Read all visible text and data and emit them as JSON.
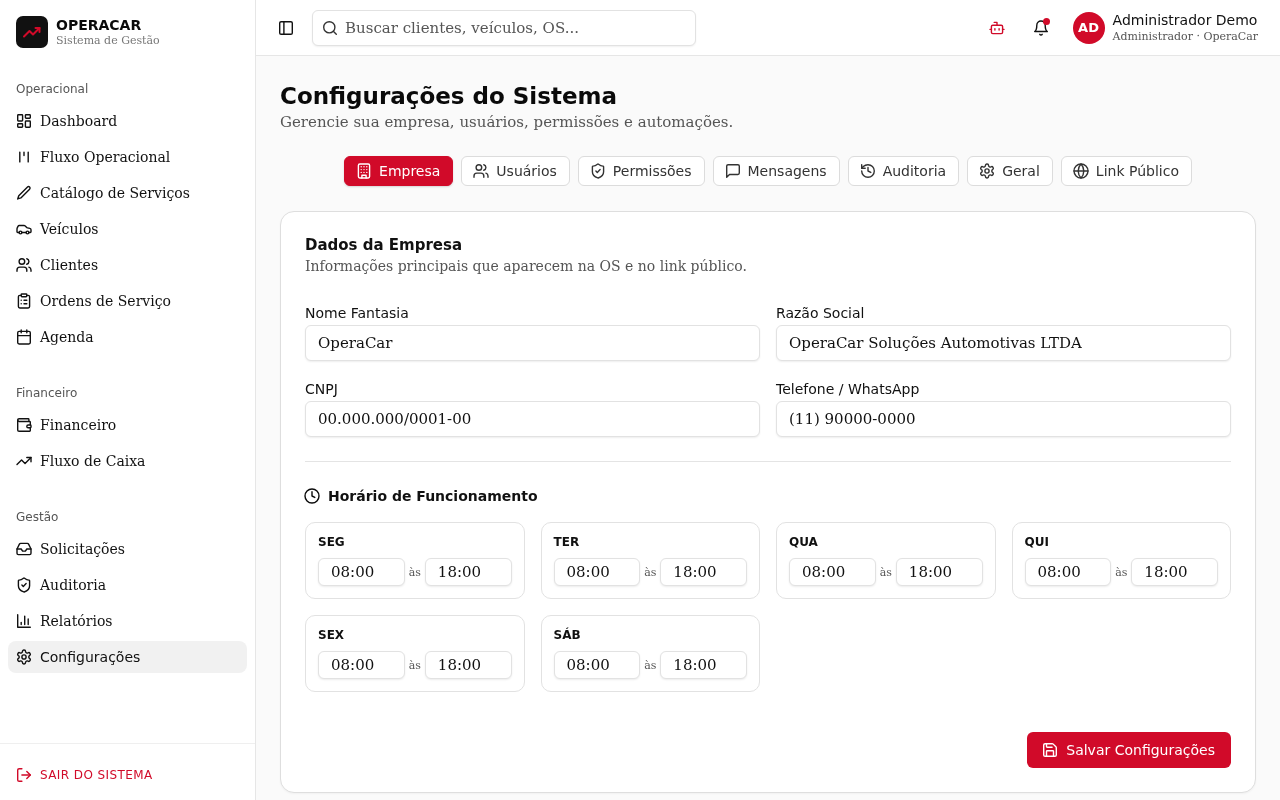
{
  "sidebar": {
    "brand": {
      "name": "OPERACAR",
      "subtitle": "Sistema de Gestão"
    },
    "sections": [
      {
        "title": "Operacional",
        "items": [
          {
            "label": "Dashboard",
            "selected": false
          },
          {
            "label": "Fluxo Operacional",
            "selected": false
          },
          {
            "label": "Catálogo de Serviços",
            "selected": false
          },
          {
            "label": "Veículos",
            "selected": false
          },
          {
            "label": "Clientes",
            "selected": false
          },
          {
            "label": "Ordens de Serviço",
            "selected": false
          },
          {
            "label": "Agenda",
            "selected": false
          }
        ]
      },
      {
        "title": "Financeiro",
        "items": [
          {
            "label": "Financeiro",
            "selected": false
          },
          {
            "label": "Fluxo de Caixa",
            "selected": false
          }
        ]
      },
      {
        "title": "Gestão",
        "items": [
          {
            "label": "Solicitações",
            "selected": false
          },
          {
            "label": "Auditoria",
            "selected": false
          },
          {
            "label": "Relatórios",
            "selected": false
          },
          {
            "label": "Configurações",
            "selected": true
          }
        ]
      }
    ],
    "logout": "SAIR DO SISTEMA"
  },
  "topbar": {
    "search": {
      "placeholder": "Buscar clientes, veículos, OS..."
    },
    "notifications": {
      "unread": true
    },
    "user": {
      "initials": "AD",
      "name": "Administrador Demo",
      "role": "Administrador · OperaCar"
    }
  },
  "page": {
    "title": "Configurações do Sistema",
    "subtitle": "Gerencie sua empresa, usuários, permissões e automações."
  },
  "tabs": [
    {
      "label": "Empresa",
      "selected": true
    },
    {
      "label": "Usuários",
      "selected": false
    },
    {
      "label": "Permissões",
      "selected": false
    },
    {
      "label": "Mensagens",
      "selected": false
    },
    {
      "label": "Auditoria",
      "selected": false
    },
    {
      "label": "Geral",
      "selected": false
    },
    {
      "label": "Link Público",
      "selected": false
    }
  ],
  "company_card": {
    "title": "Dados da Empresa",
    "subtitle": "Informações principais que aparecem na OS e no link público.",
    "fields": [
      {
        "label": "Nome Fantasia",
        "value": "OperaCar"
      },
      {
        "label": "Razão Social",
        "value": "OperaCar Soluções Automotivas LTDA"
      },
      {
        "label": "CNPJ",
        "value": "00.000.000/0001-00"
      },
      {
        "label": "Telefone / WhatsApp",
        "value": "(11) 90000-0000"
      }
    ],
    "hours": {
      "title": "Horário de Funcionamento",
      "days": [
        {
          "day": "SEG",
          "open": "08:00",
          "separator": "às",
          "close": "18:00"
        },
        {
          "day": "TER",
          "open": "08:00",
          "separator": "às",
          "close": "18:00"
        },
        {
          "day": "QUA",
          "open": "08:00",
          "separator": "às",
          "close": "18:00"
        },
        {
          "day": "QUI",
          "open": "08:00",
          "separator": "às",
          "close": "18:00"
        },
        {
          "day": "SEX",
          "open": "08:00",
          "separator": "às",
          "close": "18:00"
        },
        {
          "day": "SÁB",
          "open": "08:00",
          "separator": "às",
          "close": "18:00"
        }
      ]
    },
    "save_button": "Salvar Configurações"
  }
}
